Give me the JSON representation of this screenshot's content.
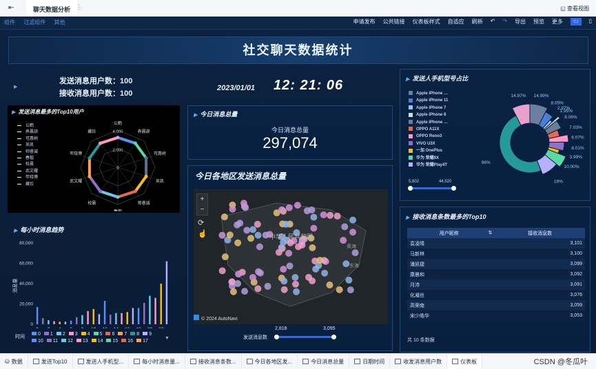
{
  "app": {
    "tab_title": "聊天数据分析",
    "view_btn": "查看视图"
  },
  "toolbar": {
    "left": [
      "组件",
      "过滤组件",
      "其他"
    ],
    "right": [
      "申请发布",
      "公共链接",
      "仪表板样式",
      "自适应",
      "刷新",
      "导出",
      "预览",
      "更多"
    ]
  },
  "dashboard": {
    "title": "社交聊天数据统计",
    "senders_label": "发送消息用户数：100",
    "receivers_label": "接收消息用户数：100",
    "date": "2023/01/01",
    "time": "12: 21: 06"
  },
  "radar": {
    "title": "发送消息最多的Top10用户",
    "legend": [
      "公鹤",
      "养晨颉",
      "可惠树",
      "吴凯",
      "帅睿诚",
      "春楷",
      "校晨",
      "武文耀",
      "年晓博",
      "藏珍"
    ],
    "axis_ticks": [
      "4,000",
      "2,000",
      "0"
    ],
    "colors": [
      "#5b8ff9",
      "#5ad8a6",
      "#5d7092",
      "#f6bd16",
      "#e8684a",
      "#6dc8ec",
      "#9270ca",
      "#ff9d4d",
      "#269a99",
      "#ff99c3"
    ]
  },
  "today_total": {
    "title": "今日消息总量",
    "label": "今日消息总量",
    "value": "297,074"
  },
  "map": {
    "title": "今日各地区发送消息总量",
    "country_label": "中华人民共和国",
    "sea_label": "东海",
    "sea_label2": "黄海",
    "copyright": "© 2024 AutoNavi",
    "zoom_in": "+",
    "zoom_out": "−",
    "range_label": "发送消息数",
    "range_min": "2,818",
    "range_max": "3,095"
  },
  "hourly": {
    "title": "每小时消息趋势",
    "ylabel": "消息量",
    "yticks": [
      "80,000",
      "60,000",
      "40,000",
      "20,000",
      "0"
    ],
    "legend_title": "时间",
    "legend_row1": [
      "0",
      "1",
      "2",
      "3",
      "4",
      "5",
      "6",
      "7",
      "8",
      "9"
    ],
    "legend_row2": [
      "10",
      "11",
      "12",
      "13",
      "14",
      "15",
      "16",
      "17"
    ]
  },
  "chart_data": [
    {
      "type": "bar",
      "title": "每小时消息趋势",
      "ylabel": "消息量",
      "ylim": [
        0,
        80000
      ],
      "categories": [
        "0",
        "1",
        "2",
        "3",
        "4",
        "5",
        "6",
        "7",
        "8",
        "9",
        "10",
        "11",
        "12",
        "13",
        "14",
        "15",
        "16",
        "17",
        "18",
        "19",
        "20",
        "21",
        "22",
        "23"
      ],
      "values": [
        17000,
        6000,
        4000,
        3000,
        2500,
        2500,
        3500,
        7000,
        9000,
        13000,
        15000,
        10000,
        23000,
        9500,
        11000,
        11000,
        12000,
        16000,
        16000,
        21000,
        28000,
        26000,
        40000,
        62000
      ],
      "xticks": [
        "0",
        "2",
        "4",
        "6",
        "8",
        "10",
        "12",
        "14",
        "16",
        "18",
        "20",
        "22"
      ]
    },
    {
      "type": "pie",
      "title": "发送人手机型号占比",
      "legend": [
        "Apple iPhone …",
        "Apple iPhone 11",
        "Apple iPhone 7",
        "Apple iPhone 8",
        "Apple iPhone …",
        "OPPO A11X",
        "OPPO Reno3",
        "VIVO U3X",
        "一加 OnePlus",
        "华为 荣耀9X",
        "华为 荣耀Play4T"
      ],
      "slice_labels": [
        "14.99%",
        "8.05%",
        "2.97%",
        "1.95%",
        "8.06%",
        "7.03%",
        "6.07%",
        "8.01%",
        "3.99%",
        "10.00%",
        "16%",
        "96%",
        "14.97%"
      ],
      "range_min": "5,802",
      "range_max": "44,520"
    },
    {
      "type": "table",
      "title": "接收消息条数最多的Top10",
      "columns": [
        "用户昵称",
        "接收消息数"
      ],
      "rows": [
        [
          "袁凌晴",
          "3,101"
        ],
        [
          "马新林",
          "3,100"
        ],
        [
          "潘凯捷",
          "3,099"
        ],
        [
          "康晨和",
          "3,092"
        ],
        [
          "月沛",
          "3,091"
        ],
        [
          "化凝丝",
          "3,076"
        ],
        [
          "高荣南",
          "3,059"
        ],
        [
          "宋少皓华",
          "3,053"
        ]
      ],
      "footer": "共 10 条数据"
    }
  ],
  "bottom_tabs": [
    "数据",
    "发送Top10",
    "发送人手机型...",
    "每小时消息量...",
    "接收消息条数...",
    "今日各地区发...",
    "今日消息总量",
    "日期时间",
    "收发消息用户数",
    "仪表板"
  ],
  "watermark": "CSDN @冬瓜叶"
}
